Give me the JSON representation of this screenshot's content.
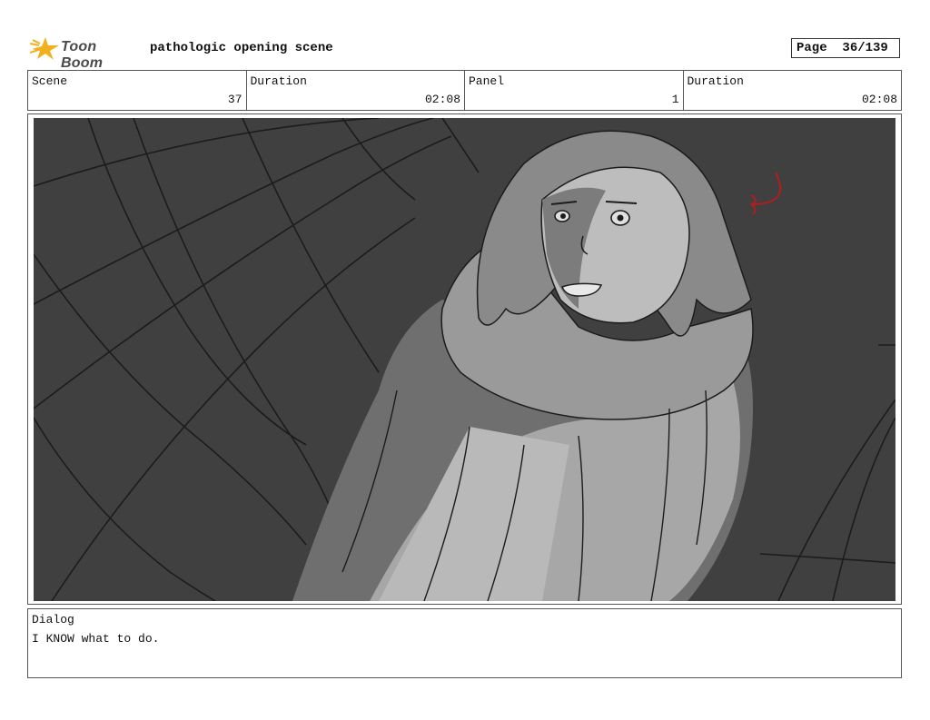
{
  "header": {
    "logo_text": "Toon Boom",
    "document_title": "pathologic opening scene",
    "page_label": "Page",
    "page_value": "36/139"
  },
  "info": {
    "scene_label": "Scene",
    "scene_value": "37",
    "duration_label": "Duration",
    "duration_value": "02:08",
    "panel_label": "Panel",
    "panel_value": "1",
    "panel_duration_label": "Duration",
    "panel_duration_value": "02:08"
  },
  "dialog": {
    "label": "Dialog",
    "text": "I KNOW what to do."
  },
  "colors": {
    "logo_star": "#f2b01e",
    "artwork_bg": "#404040",
    "annotation_arrow": "#b01e1e"
  }
}
